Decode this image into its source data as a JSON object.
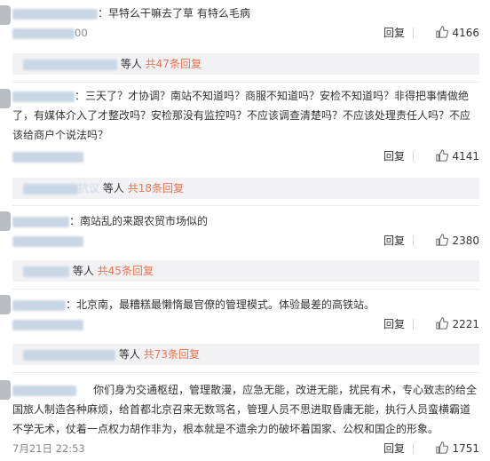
{
  "colors": {
    "link": "#eb7350",
    "text": "#333333",
    "muted": "#888888",
    "subbg": "#f2f2f5"
  },
  "comments": [
    {
      "text": "早特么干嘛去了草 有特么毛病",
      "time": "00",
      "reply_label": "回复",
      "likes": "4166",
      "sub": {
        "suffix": "等人",
        "more": "共47条回复"
      }
    },
    {
      "text": "三天了？才协调？南站不知道吗？商服不知道吗？安检不知道吗？非得把事情做绝了，有媒体介入了才整改吗？安检那没有监控吗？不应该调查清楚吗？不应该处理责任人吗？不应该给商户个说法吗？",
      "reply_label": "回复",
      "likes": "4141",
      "sub": {
        "name_fragment": "抗议",
        "suffix": "等人",
        "more": "共18条回复"
      }
    },
    {
      "text": "南站乱的来跟农贸市场似的",
      "reply_label": "回复",
      "likes": "2380",
      "sub": {
        "suffix": "等人",
        "more": "共45条回复"
      }
    },
    {
      "text": "北京南，最糟糕最懒惰最官僚的管理模式。体验最差的高铁站。",
      "reply_label": "回复",
      "likes": "2221",
      "sub": {
        "suffix": "等人",
        "more": "共73条回复"
      }
    },
    {
      "text": "你们身为交通枢纽，管理散漫，应急无能，改进无能，扰民有术，专心致志的给全国旅人制造各种麻烦，给首都北京召来无数骂名，管理人员不思进取昏庸无能，执行人员蛮横霸道不学无术，仗着一点权力胡作非为，根本就是不遗余力的破坏着国家、公权和国企的形象。",
      "time": "7月21日 22:53",
      "reply_label": "回复",
      "likes": "1751"
    }
  ]
}
